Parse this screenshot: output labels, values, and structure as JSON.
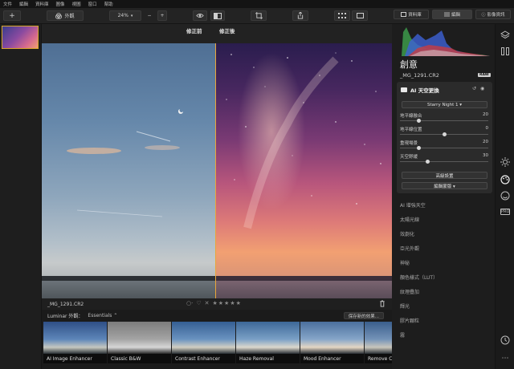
{
  "menu": [
    "文件",
    "編輯",
    "資料庫",
    "圖像",
    "視圖",
    "窗口",
    "幫助"
  ],
  "toolbar": {
    "add_label": "+",
    "looks_label": "外觀",
    "zoom_value": "24%",
    "zoom_minus": "−",
    "zoom_plus": "+"
  },
  "tabs": {
    "library": "資料庫",
    "edit": "編輯",
    "info": "影像資訊"
  },
  "canvas": {
    "before_label": "修正前",
    "after_label": "修正後"
  },
  "infobar": {
    "filename": "_MG_1291.CR2"
  },
  "presets": {
    "title": "Luminar 外觀：",
    "category": "Essentials ⌃",
    "save_label": "保存新的效果...",
    "items": [
      {
        "label": "AI Image Enhancer"
      },
      {
        "label": "Classic B&W"
      },
      {
        "label": "Contrast Enhancer"
      },
      {
        "label": "Haze Removal"
      },
      {
        "label": "Mood Enhancer"
      },
      {
        "label": "Remove C"
      }
    ]
  },
  "panel": {
    "title": "創意",
    "filename": "_MG_1291.CR2",
    "raw_badge": "RAW",
    "tool_card": {
      "title": "AI 天空更換",
      "sky_selection": "Starry Night 1 ▾",
      "sliders": [
        {
          "label": "地平線融合",
          "value": "20",
          "fraction": 0.2
        },
        {
          "label": "地平線位置",
          "value": "0",
          "fraction": 0.5
        },
        {
          "label": "重現場景",
          "value": "20",
          "fraction": 0.2
        },
        {
          "label": "天空舒緩",
          "value": "30",
          "fraction": 0.3
        }
      ],
      "advanced_label": "高級設置",
      "mask_label": "編輯蒙版 ▾"
    },
    "tools": [
      "AI 增強天空",
      "太陽光線",
      "效劇化",
      "亞光外觀",
      "神秘",
      "顏色樣式（LUT）",
      "紋理疊加",
      "輝光",
      "膠片顆粒",
      "霧"
    ]
  },
  "colors": {
    "accent": "#e8a63a",
    "panel_bg": "#1d1d1d",
    "card_bg": "#2b2b2b"
  }
}
